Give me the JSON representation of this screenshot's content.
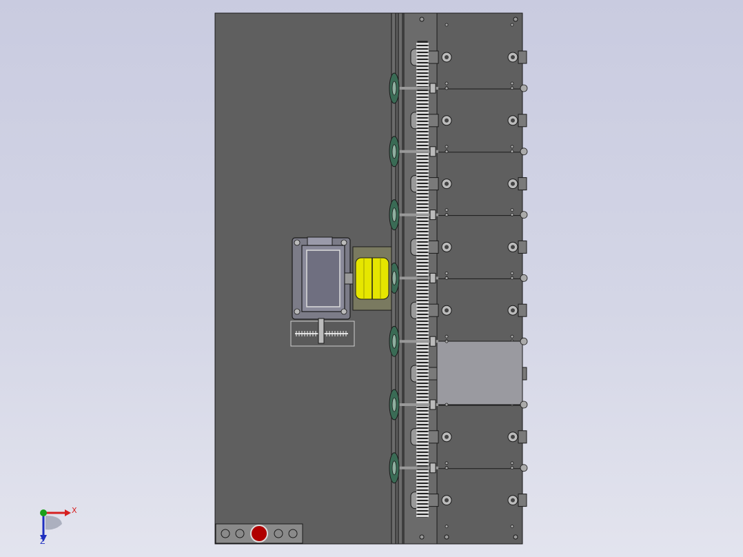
{
  "viewport": {
    "background_top": "#c9cbe0",
    "background_bottom": "#e3e4ee"
  },
  "colors": {
    "frame_dark": "#5f5f5f",
    "frame_mid": "#6b6b6b",
    "panel_light": "#9a9aa0",
    "outline": "#1a1a1a",
    "motor_body": "#8a8a9a",
    "coupling_yellow": "#e6e600",
    "sprocket_green": "#3a6b55",
    "stop_button": "#b00000",
    "axis_x": "#d62020",
    "axis_y": "#1aa01a",
    "axis_z": "#2030c0"
  },
  "model": {
    "roller_rows": 8,
    "sprocket_rows": 7,
    "control_box_buttons": 5
  },
  "triad": {
    "x_label": "X",
    "z_label": "Z",
    "icon": "coordinate-triad-icon"
  },
  "icons": {
    "motor": "gear-motor-icon",
    "coupling": "coupling-icon",
    "sprocket": "sprocket-icon",
    "stop": "emergency-stop-icon"
  }
}
